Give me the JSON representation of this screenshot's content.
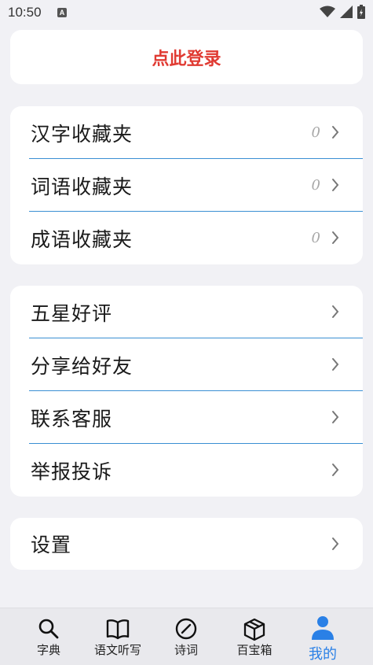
{
  "status_bar": {
    "time": "10:50",
    "notification_icon": "A"
  },
  "login": {
    "label": "点此登录",
    "color": "#e03a32"
  },
  "favorites": [
    {
      "label": "汉字收藏夹",
      "count": "0"
    },
    {
      "label": "词语收藏夹",
      "count": "0"
    },
    {
      "label": "成语收藏夹",
      "count": "0"
    }
  ],
  "actions": [
    {
      "label": "五星好评"
    },
    {
      "label": "分享给好友"
    },
    {
      "label": "联系客服"
    },
    {
      "label": "举报投诉"
    }
  ],
  "settings": {
    "label": "设置"
  },
  "tabs": [
    {
      "label": "字典",
      "icon": "search-icon"
    },
    {
      "label": "语文听写",
      "icon": "book-icon"
    },
    {
      "label": "诗词",
      "icon": "compass-icon"
    },
    {
      "label": "百宝箱",
      "icon": "box-icon"
    },
    {
      "label": "我的",
      "icon": "person-icon",
      "active": true
    }
  ],
  "colors": {
    "accent": "#2a80e6",
    "divider": "#3a8fd3"
  }
}
